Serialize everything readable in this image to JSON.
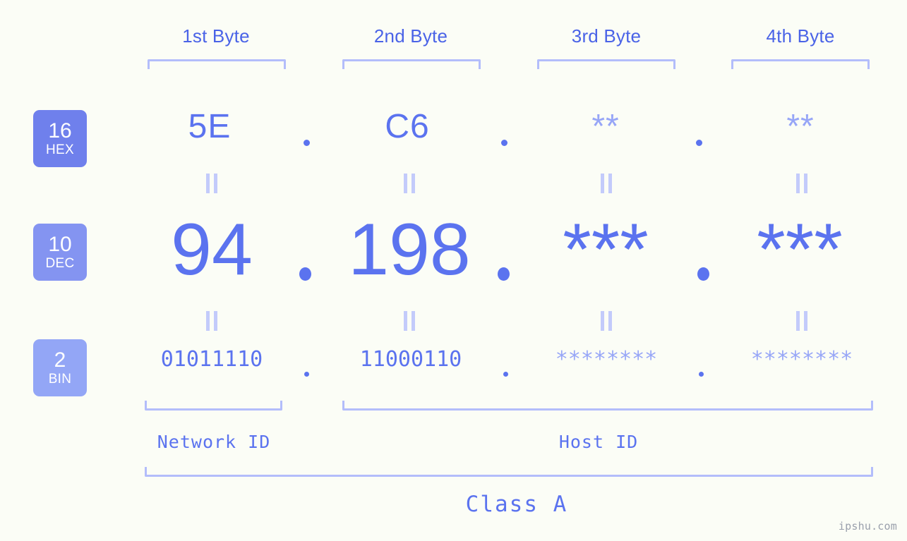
{
  "meta": {
    "watermark": "ipshu.com",
    "background_color": "#fbfdf6",
    "accent_color": "#5b73ef",
    "accent_light_color": "#97a6f7",
    "bracket_color": "#b3bdfb"
  },
  "headers": {
    "byte1": "1st Byte",
    "byte2": "2nd Byte",
    "byte3": "3rd Byte",
    "byte4": "4th Byte"
  },
  "bases": [
    {
      "number": "16",
      "name": "HEX",
      "color": "#6f80ec"
    },
    {
      "number": "10",
      "name": "DEC",
      "color": "#8494f1"
    },
    {
      "number": "2",
      "name": "BIN",
      "color": "#93a6f6"
    }
  ],
  "rows": {
    "hex": {
      "label_number": "16",
      "label_name": "HEX",
      "values": [
        "5E",
        "C6",
        "**",
        "**"
      ],
      "separator": "."
    },
    "dec": {
      "label_number": "10",
      "label_name": "DEC",
      "values": [
        "94",
        "198",
        "***",
        "***"
      ],
      "separator": "."
    },
    "bin": {
      "label_number": "2",
      "label_name": "BIN",
      "values": [
        "01011110",
        "11000110",
        "********",
        "********"
      ],
      "separator": "."
    }
  },
  "connectors": {
    "symbol": "="
  },
  "footer": {
    "network_id": "Network ID",
    "host_id": "Host ID",
    "class": "Class A"
  }
}
